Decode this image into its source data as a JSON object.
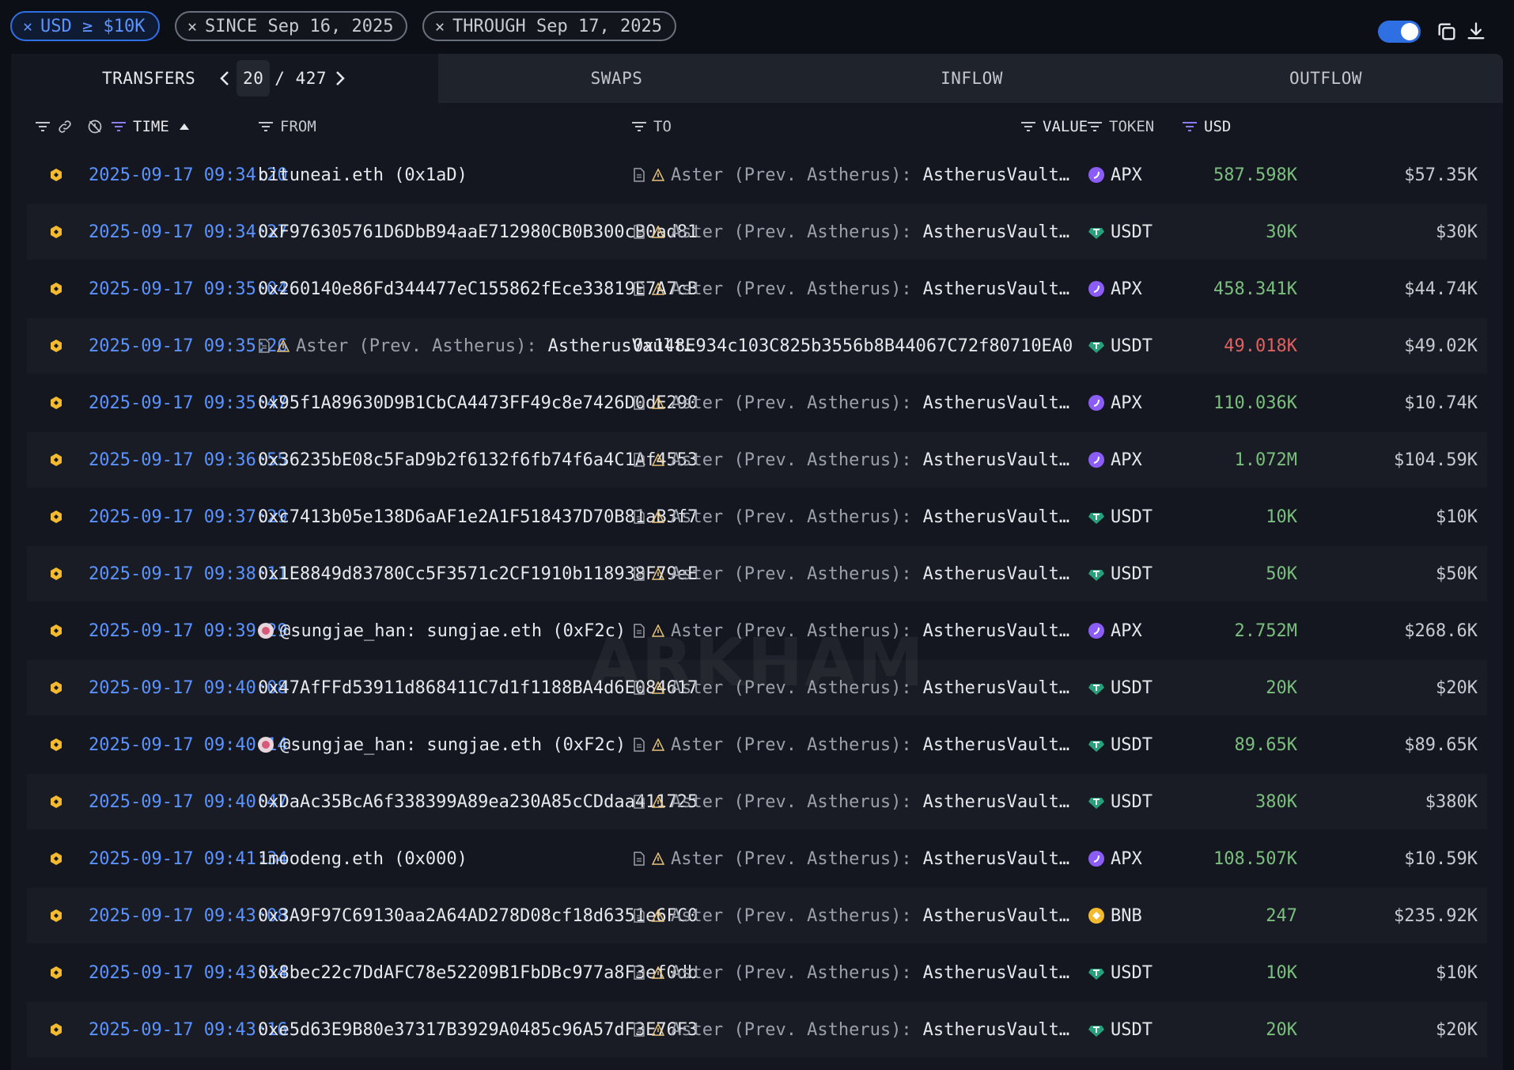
{
  "filters": {
    "usd": "USD ≥ $10K",
    "since": "SINCE Sep 16, 2025",
    "through": "THROUGH Sep 17, 2025"
  },
  "tabs": {
    "transfers": "TRANSFERS",
    "page_current": "20",
    "page_total": "/ 427",
    "swaps": "SWAPS",
    "inflow": "INFLOW",
    "outflow": "OUTFLOW"
  },
  "columns": {
    "time": "TIME",
    "from": "FROM",
    "to": "TO",
    "value": "VALUE",
    "token": "TOKEN",
    "usd": "USD"
  },
  "watermark": "ARKHAM",
  "colors": {
    "accent": "#2f6fe4",
    "time_text": "#5b93ff",
    "value_in": "#7bbf7f",
    "value_out": "#e06161",
    "apx": "#8b5cf6",
    "usdt": "#26a17b",
    "bnb": "#f3ba2f"
  },
  "entity": {
    "prefix": "Aster (Prev. Astherus):",
    "name": "AstherusVault…"
  },
  "rows": [
    {
      "time": "2025-09-17 09:34:20",
      "from": "bituneai.eth (0x1aD)",
      "to_type": "entity",
      "value": "587.598K",
      "token": "APX",
      "usd": "$57.35K"
    },
    {
      "time": "2025-09-17 09:34:27",
      "from": "0xF976305761D6DbB94aaE712980CB0B300cB0ad81",
      "to_type": "entity",
      "value": "30K",
      "token": "USDT",
      "usd": "$30K"
    },
    {
      "time": "2025-09-17 09:35:04",
      "from": "0x260140e86Fd344477eC155862fEce33819E7A7cB",
      "to_type": "entity",
      "value": "458.341K",
      "token": "APX",
      "usd": "$44.74K"
    },
    {
      "time": "2025-09-17 09:35:26",
      "from": "",
      "to": "0x148E934c103C825b3556b8B44067C72f80710EA0",
      "to_type": "address",
      "value": "49.018K",
      "token": "USDT",
      "usd": "$49.02K"
    },
    {
      "time": "2025-09-17 09:35:47",
      "from": "0x95f1A89630D9B1CbCA4473FF49c8e7426D0dE290",
      "to_type": "entity",
      "value": "110.036K",
      "token": "APX",
      "usd": "$10.74K"
    },
    {
      "time": "2025-09-17 09:36:55",
      "from": "0x36235bE08c5FaD9b2f6132f6fb74f6a4C1Af4553",
      "to_type": "entity",
      "value": "1.072M",
      "token": "APX",
      "usd": "$104.59K"
    },
    {
      "time": "2025-09-17 09:37:29",
      "from": "0xc7413b05e138D6aAF1e2A1F518437D70B81aB3f7",
      "to_type": "entity",
      "value": "10K",
      "token": "USDT",
      "usd": "$10K"
    },
    {
      "time": "2025-09-17 09:38:11",
      "from": "0x1E8849d83780Cc5F3571c2CF1910b118938F79eE",
      "to_type": "entity",
      "value": "50K",
      "token": "USDT",
      "usd": "$50K"
    },
    {
      "time": "2025-09-17 09:39:29",
      "from": "@sungjae_han: sungjae.eth (0xF2c)",
      "to_type": "entity",
      "value": "2.752M",
      "token": "APX",
      "usd": "$268.6K"
    },
    {
      "time": "2025-09-17 09:40:08",
      "from": "0x47AfFFd53911d868411C7d1f1188BA4d6E084617",
      "to_type": "entity",
      "value": "20K",
      "token": "USDT",
      "usd": "$20K"
    },
    {
      "time": "2025-09-17 09:40:14",
      "from": "@sungjae_han: sungjae.eth (0xF2c)",
      "to_type": "entity",
      "value": "89.65K",
      "token": "USDT",
      "usd": "$89.65K"
    },
    {
      "time": "2025-09-17 09:40:47",
      "from": "0xDaAc35BcA6f338399A89ea230A85cCDdaa411725",
      "to_type": "entity",
      "value": "380K",
      "token": "USDT",
      "usd": "$380K"
    },
    {
      "time": "2025-09-17 09:41:34",
      "from": "1moodeng.eth (0x000)",
      "to_type": "entity",
      "value": "108.507K",
      "token": "APX",
      "usd": "$10.59K"
    },
    {
      "time": "2025-09-17 09:43:08",
      "from": "0x3A9F97C69130aa2A64AD278D08cf18d6351e6FC0",
      "to_type": "entity",
      "value": "247",
      "token": "BNB",
      "usd": "$235.92K"
    },
    {
      "time": "2025-09-17 09:43:14",
      "from": "0x8bec22c7DdAFC78e52209B1FbDBc977a8F3ef0db",
      "to_type": "entity",
      "value": "10K",
      "token": "USDT",
      "usd": "$10K"
    },
    {
      "time": "2025-09-17 09:43:16",
      "from": "0xe5d63E9B80e37317B3929A0485c96A57dF3E76F3",
      "to_type": "entity",
      "value": "20K",
      "token": "USDT",
      "usd": "$20K"
    }
  ]
}
